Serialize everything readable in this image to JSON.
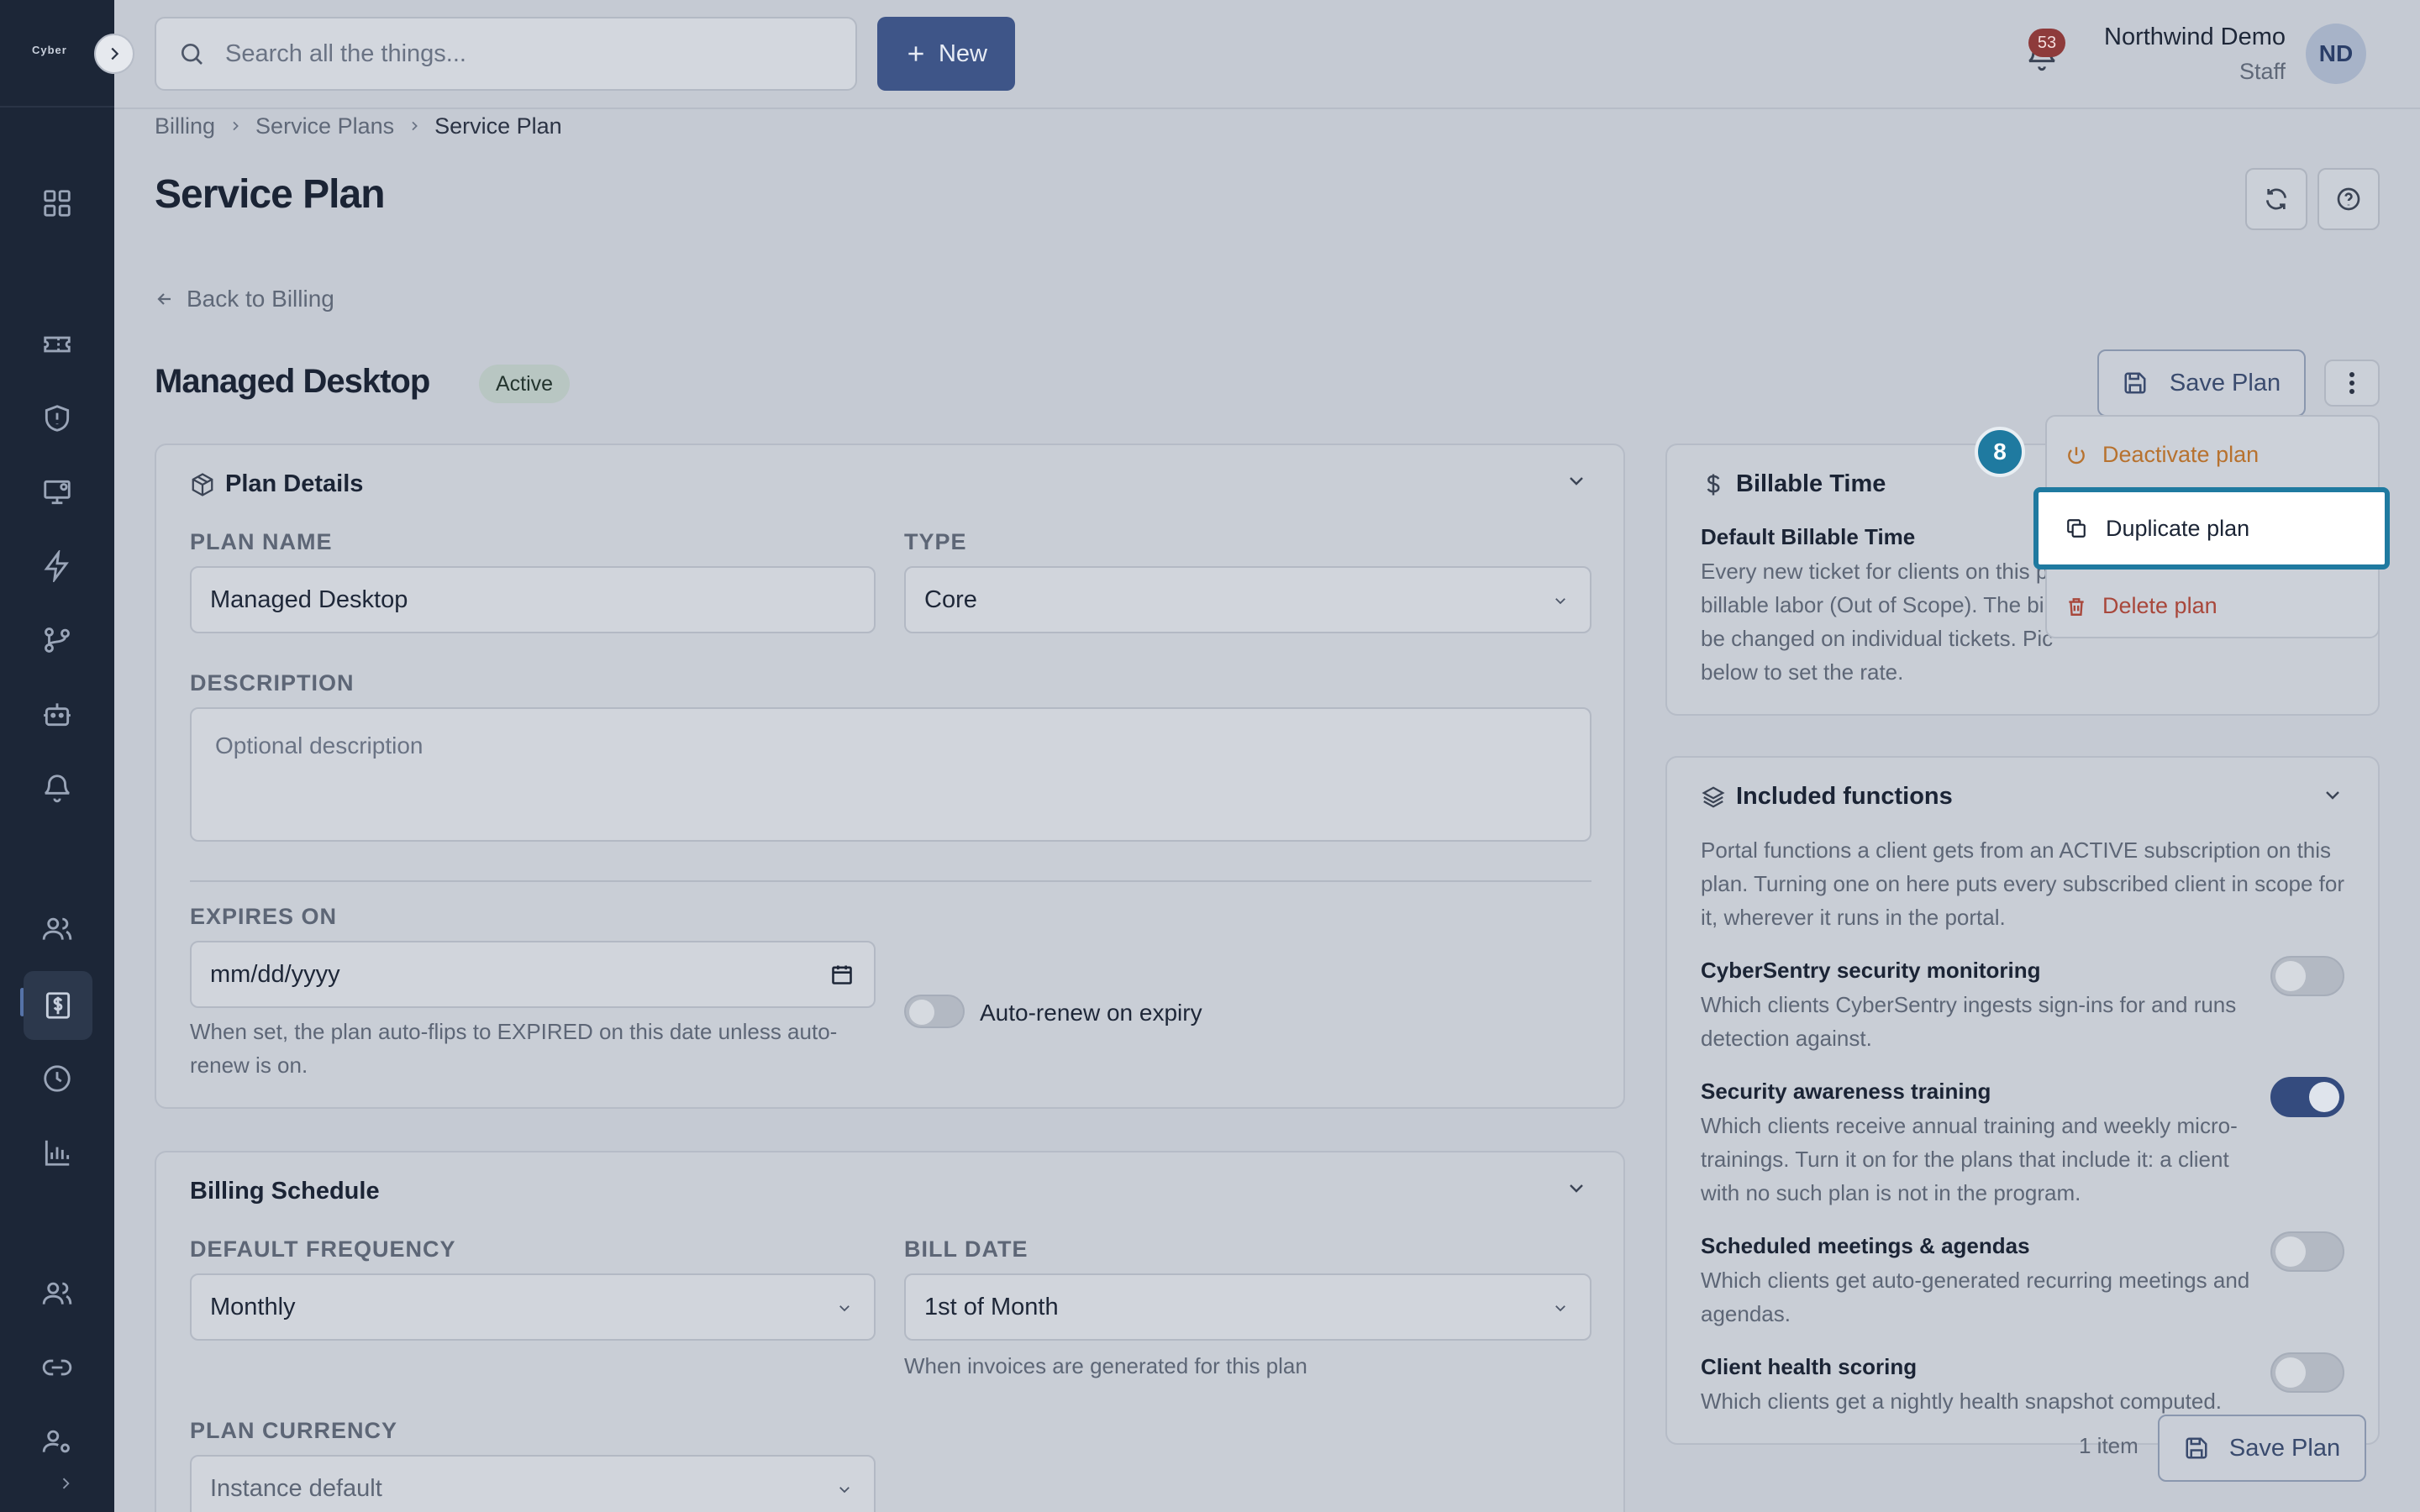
{
  "app": {
    "logo_text": "Cyber"
  },
  "topbar": {
    "search_placeholder": "Search all the things...",
    "new_label": "New",
    "notification_count": "53",
    "user_name": "Northwind Demo",
    "user_role": "Staff",
    "avatar_initials": "ND"
  },
  "breadcrumb": [
    "Billing",
    "Service Plans",
    "Service Plan"
  ],
  "page": {
    "title": "Service Plan",
    "back_label": "Back to Billing",
    "plan_title": "Managed Desktop",
    "status": "Active",
    "save_label": "Save Plan"
  },
  "menu": {
    "step_number": "8",
    "items": [
      "Deactivate plan",
      "Duplicate plan",
      "Delete plan"
    ]
  },
  "plan_details": {
    "heading": "Plan Details",
    "name_label": "PLAN NAME",
    "name_value": "Managed Desktop",
    "type_label": "TYPE",
    "type_value": "Core",
    "description_label": "DESCRIPTION",
    "description_placeholder": "Optional description",
    "expires_label": "EXPIRES ON",
    "expires_placeholder": "mm/dd/yyyy",
    "expires_help": "When set, the plan auto-flips to EXPIRED on this date unless auto-renew is on.",
    "auto_renew_label": "Auto-renew on expiry"
  },
  "billing_schedule": {
    "heading": "Billing Schedule",
    "frequency_label": "DEFAULT FREQUENCY",
    "frequency_value": "Monthly",
    "bill_date_label": "BILL DATE",
    "bill_date_value": "1st of Month",
    "bill_date_help": "When invoices are generated for this plan",
    "currency_label": "PLAN CURRENCY",
    "currency_value": "Instance default"
  },
  "billable_time": {
    "heading": "Billable Time",
    "subheading": "Default Billable Time",
    "line1": "Every new ticket for clients on this p",
    "line2": "billable labor (Out of Scope). The bi",
    "line3": "be changed on individual tickets. Pic",
    "line4": "below to set the rate."
  },
  "included_functions": {
    "heading": "Included functions",
    "description": "Portal functions a client gets from an ACTIVE subscription on this plan. Turning one on here puts every subscribed client in scope for it, wherever it runs in the portal.",
    "items": [
      {
        "title": "CyberSentry security monitoring",
        "desc": "Which clients CyberSentry ingests sign-ins for and runs detection against.",
        "enabled": false
      },
      {
        "title": "Security awareness training",
        "desc": "Which clients receive annual training and weekly micro-trainings. Turn it on for the plans that include it: a client with no such plan is not in the program.",
        "enabled": true
      },
      {
        "title": "Scheduled meetings & agendas",
        "desc": "Which clients get auto-generated recurring meetings and agendas.",
        "enabled": false
      },
      {
        "title": "Client health scoring",
        "desc": "Which clients get a nightly health snapshot computed.",
        "enabled": false
      }
    ]
  },
  "footer": {
    "items_count": "1 item",
    "save_label": "Save Plan"
  },
  "colors": {
    "accent": "#3e5588",
    "highlight": "#1f7aa0",
    "warn": "#b7722f",
    "danger": "#a8473b"
  }
}
